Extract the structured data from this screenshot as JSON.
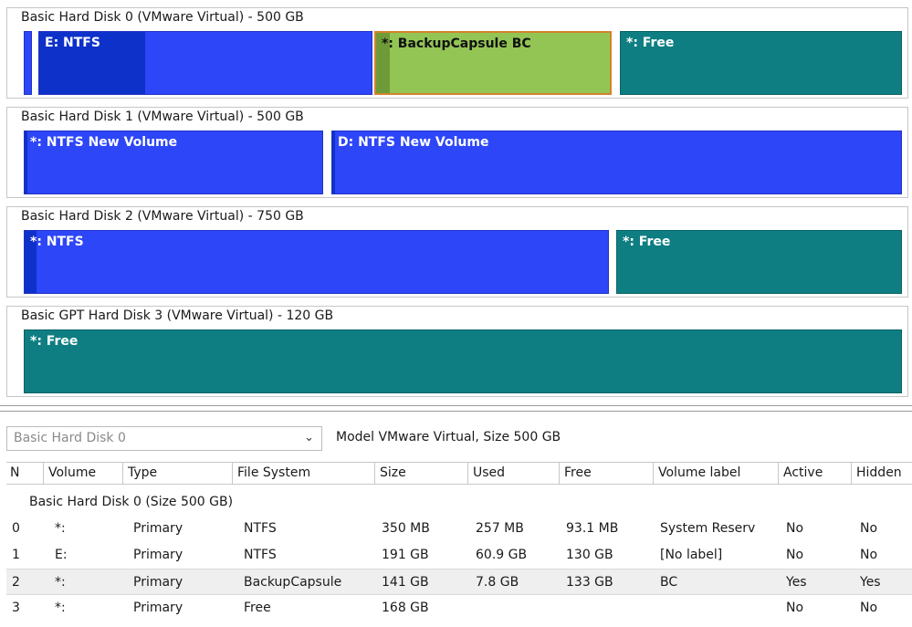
{
  "disks": [
    {
      "title": "Basic Hard Disk 0 (VMware Virtual) - 500 GB",
      "partitions": [
        {
          "label": "E: NTFS",
          "kind": "ntfs",
          "used_fraction": 0.32
        },
        {
          "label": "*: BackupCapsule BC",
          "kind": "backup",
          "used_fraction": 0.06
        },
        {
          "label": "*: Free",
          "kind": "free"
        }
      ]
    },
    {
      "title": "Basic Hard Disk 1 (VMware Virtual) - 500 GB",
      "partitions": [
        {
          "label": "*: NTFS New Volume",
          "kind": "ntfs"
        },
        {
          "label": "D: NTFS New Volume",
          "kind": "ntfs"
        }
      ]
    },
    {
      "title": "Basic Hard Disk 2 (VMware Virtual) - 750 GB",
      "partitions": [
        {
          "label": "*: NTFS",
          "kind": "ntfs"
        },
        {
          "label": "*: Free",
          "kind": "free"
        }
      ]
    },
    {
      "title": "Basic GPT Hard Disk 3 (VMware Virtual) - 120 GB",
      "partitions": [
        {
          "label": "*: Free",
          "kind": "free"
        }
      ]
    }
  ],
  "details": {
    "disk_select": {
      "value": "Basic Hard Disk 0",
      "arrow": "⌄"
    },
    "model_info": "Model VMware Virtual, Size 500 GB",
    "columns": [
      "N",
      "Volume",
      "Type",
      "File System",
      "Size",
      "Used",
      "Free",
      "Volume label",
      "Active",
      "Hidden"
    ],
    "group_label": "Basic Hard Disk 0 (Size 500 GB)",
    "rows": [
      {
        "n": "0",
        "volume": "*:",
        "type": "Primary",
        "fs": "NTFS",
        "size": "350 MB",
        "used": "257 MB",
        "free": "93.1 MB",
        "label": "System Reserv",
        "active": "No",
        "hidden": "No",
        "selected": false
      },
      {
        "n": "1",
        "volume": "E:",
        "type": "Primary",
        "fs": "NTFS",
        "size": "191 GB",
        "used": "60.9 GB",
        "free": "130 GB",
        "label": "[No label]",
        "active": "No",
        "hidden": "No",
        "selected": false
      },
      {
        "n": "2",
        "volume": "*:",
        "type": "Primary",
        "fs": "BackupCapsule",
        "size": "141 GB",
        "used": "7.8 GB",
        "free": "133 GB",
        "label": "BC",
        "active": "Yes",
        "hidden": "Yes",
        "selected": true
      },
      {
        "n": "3",
        "volume": "*:",
        "type": "Primary",
        "fs": "Free",
        "size": "168 GB",
        "used": "",
        "free": "",
        "label": "",
        "active": "No",
        "hidden": "No",
        "selected": false
      }
    ]
  },
  "colors": {
    "ntfs": "#2d46f8",
    "free": "#0e7e82",
    "backup": "#93c554",
    "backup_border": "#d4832a"
  }
}
